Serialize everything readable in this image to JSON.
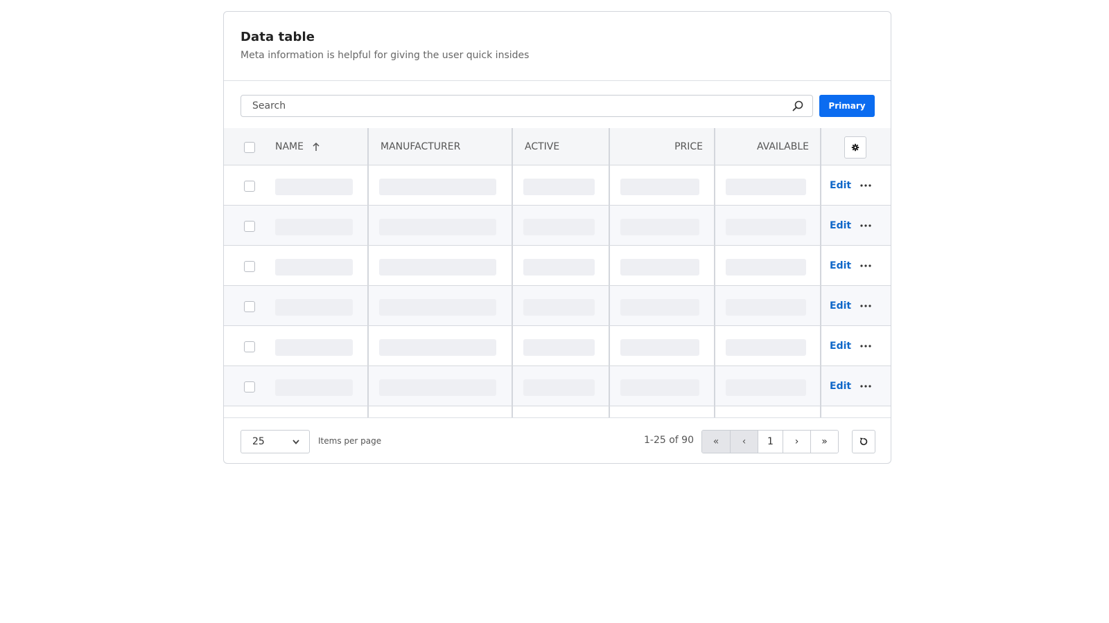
{
  "header": {
    "title": "Data table",
    "subtitle": "Meta information is helpful for giving the user quick insides"
  },
  "toolbar": {
    "search_placeholder": "Search",
    "primary_label": "Primary"
  },
  "table": {
    "columns": [
      "NAME",
      "MANUFACTURER",
      "ACTIVE",
      "PRICE",
      "AVAILABLE"
    ],
    "sort_column": "NAME",
    "sort_direction": "ascending",
    "row_action_label": "Edit",
    "loading_rows": 6
  },
  "footer": {
    "per_page_value": "25",
    "per_page_label": "Items per page",
    "range": "1-25 of 90",
    "first": "«",
    "prev": "‹",
    "page": "1",
    "next": "›",
    "last": "»"
  },
  "colors": {
    "accent": "#0b6cf0",
    "link": "#1068c9"
  },
  "icons": [
    "search-icon",
    "sort-ascending-icon",
    "gear-icon",
    "more-horizontal-icon",
    "chevron-down-icon",
    "refresh-icon"
  ]
}
